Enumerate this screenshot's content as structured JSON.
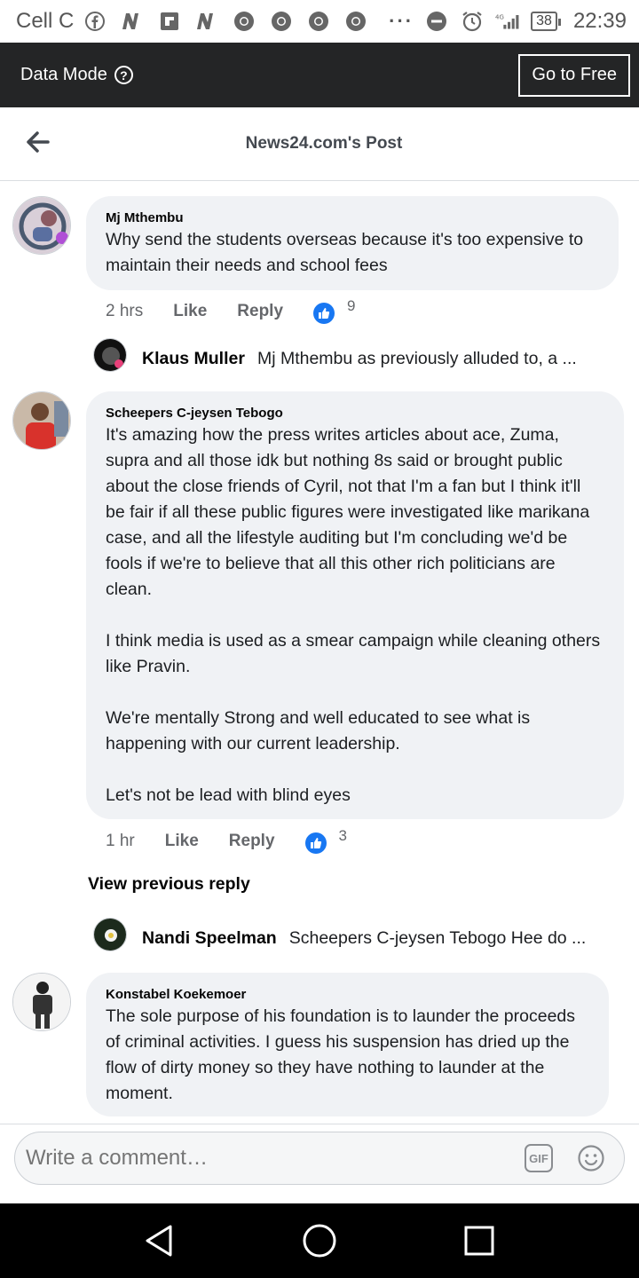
{
  "status_bar": {
    "carrier": "Cell C",
    "battery": "38",
    "time": "22:39",
    "network": "4G",
    "notification_icons": [
      "facebook-icon",
      "news-n-icon",
      "flipboard-icon",
      "news-n-icon",
      "chrome-icon",
      "chrome-icon",
      "chrome-icon",
      "chrome-icon"
    ]
  },
  "data_mode_bar": {
    "label": "Data Mode",
    "help_glyph": "?",
    "go_free_label": "Go to Free"
  },
  "header": {
    "title": "News24.com's Post"
  },
  "comments": [
    {
      "author": "Mj Mthembu",
      "text": "Why send the students overseas because it's too expensive to maintain their needs and school fees",
      "time": "2 hrs",
      "like_label": "Like",
      "reply_label": "Reply",
      "reaction_count": "9",
      "reply_preview": {
        "name": "Klaus Muller",
        "snippet": "Mj Mthembu as previously alluded to, a ..."
      }
    },
    {
      "author": "Scheepers C-jeysen Tebogo",
      "text": "It's amazing how the press writes articles about ace, Zuma, supra and all those idk but nothing 8s said or brought public about the close friends of Cyril, not that I'm a fan but I think it'll be fair if all these public figures were investigated like marikana case, and all the lifestyle auditing but I'm concluding we'd be fools if we're to believe that all this other rich politicians are clean.\n\nI think media is used as a smear campaign while cleaning others like Pravin.\n\nWe're mentally Strong and well educated to see what is happening with our current leadership.\n\nLet's not be lead with blind eyes",
      "time": "1 hr",
      "like_label": "Like",
      "reply_label": "Reply",
      "reaction_count": "3",
      "view_previous": "View previous reply",
      "reply_preview": {
        "name": "Nandi Speelman",
        "snippet": "Scheepers C-jeysen Tebogo Hee do ..."
      }
    },
    {
      "author": "Konstabel Koekemoer",
      "text": "The sole purpose of his foundation is to launder the proceeds of criminal activities. I guess his suspension has dried up the flow of dirty money so they have nothing to launder at the moment."
    }
  ],
  "composer": {
    "placeholder": "Write a comment…",
    "gif_label": "GIF"
  },
  "colors": {
    "accent": "#1877f2",
    "bubble": "#f0f2f5",
    "data_bar": "#242526"
  }
}
